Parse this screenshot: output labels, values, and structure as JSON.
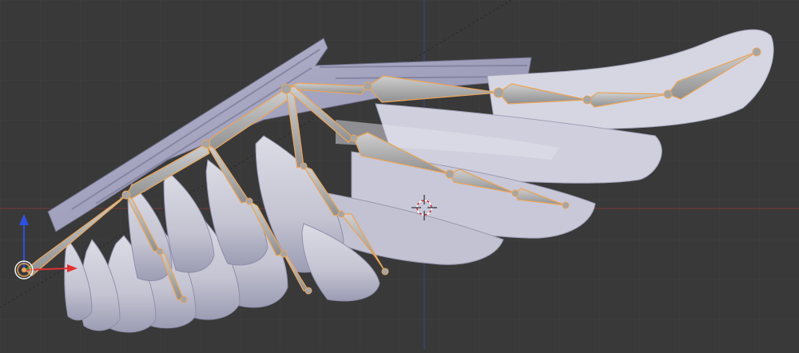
{
  "viewport": {
    "editor": "3D View",
    "background_color": "#393939",
    "grid_color": "#424242",
    "x_axis_color": "#8b3b3b",
    "y_axis_color": "#3f4f8f"
  },
  "scene": {
    "wing_mesh": {
      "color": "#c9c9d6",
      "shadow_color": "#9a9ab3"
    },
    "armature": {
      "bone_color": "#b8b8b8",
      "selected_outline_color": "#e8a55c"
    },
    "bone_count": 19
  },
  "gizmos": {
    "manipulator_colors": {
      "x": "#e03030",
      "y": "#30a030",
      "z": "#3050e0"
    },
    "origin_icon": "pivot-origin-icon",
    "cursor_icon": "3d-cursor-icon"
  }
}
